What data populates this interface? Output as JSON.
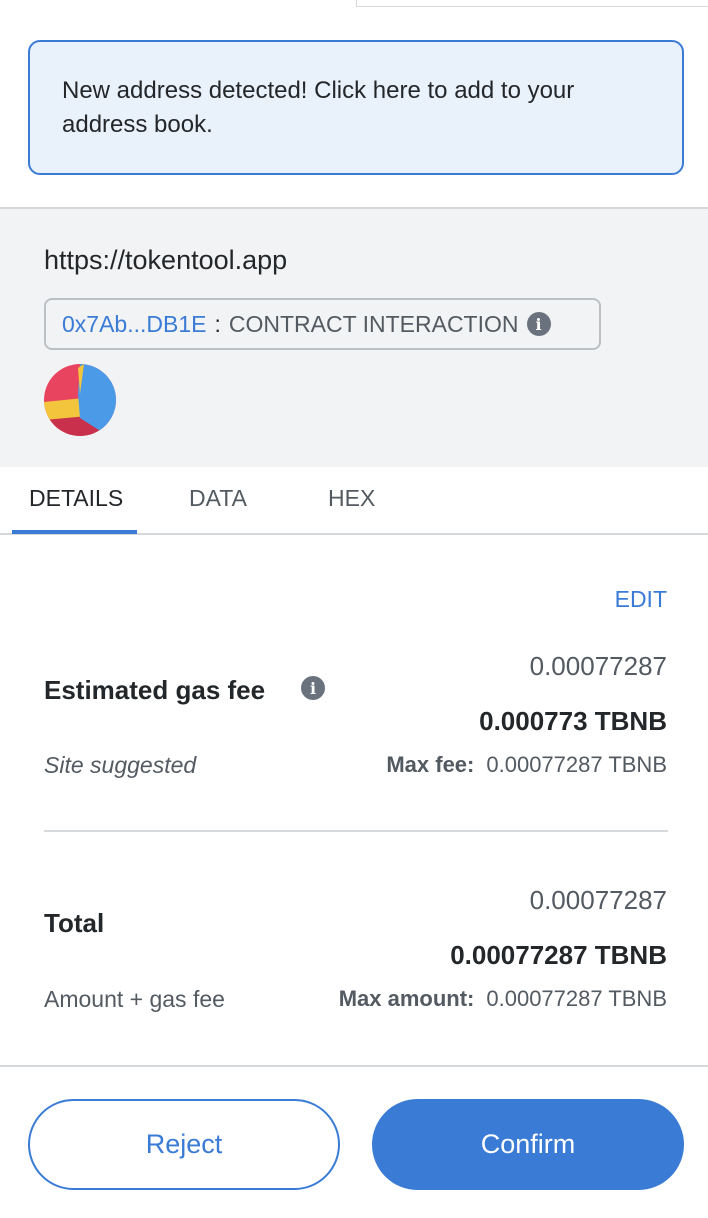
{
  "banner": {
    "text": "New address detected! Click here to add to your address book."
  },
  "origin": {
    "url": "https://tokentool.app",
    "contract_address": "0x7Ab...DB1E",
    "separator": ":",
    "contract_label": "CONTRACT INTERACTION",
    "info_icon": "info-icon"
  },
  "tabs": [
    {
      "label": "DETAILS",
      "active": true
    },
    {
      "label": "DATA",
      "active": false
    },
    {
      "label": "HEX",
      "active": false
    }
  ],
  "details": {
    "edit_label": "EDIT",
    "gas": {
      "label": "Estimated gas fee",
      "sublabel": "Site suggested",
      "secondary_value": "0.00077287",
      "primary_value": "0.000773 TBNB",
      "max_label": "Max fee:",
      "max_value": "0.00077287 TBNB"
    },
    "total": {
      "label": "Total",
      "sublabel": "Amount + gas fee",
      "secondary_value": "0.00077287",
      "primary_value": "0.00077287 TBNB",
      "max_label": "Max amount:",
      "max_value": "0.00077287 TBNB"
    }
  },
  "footer": {
    "reject_label": "Reject",
    "confirm_label": "Confirm"
  },
  "colors": {
    "accent": "#3a7bd5",
    "banner_bg": "#e9f1fb",
    "section_bg": "#f2f3f4"
  }
}
